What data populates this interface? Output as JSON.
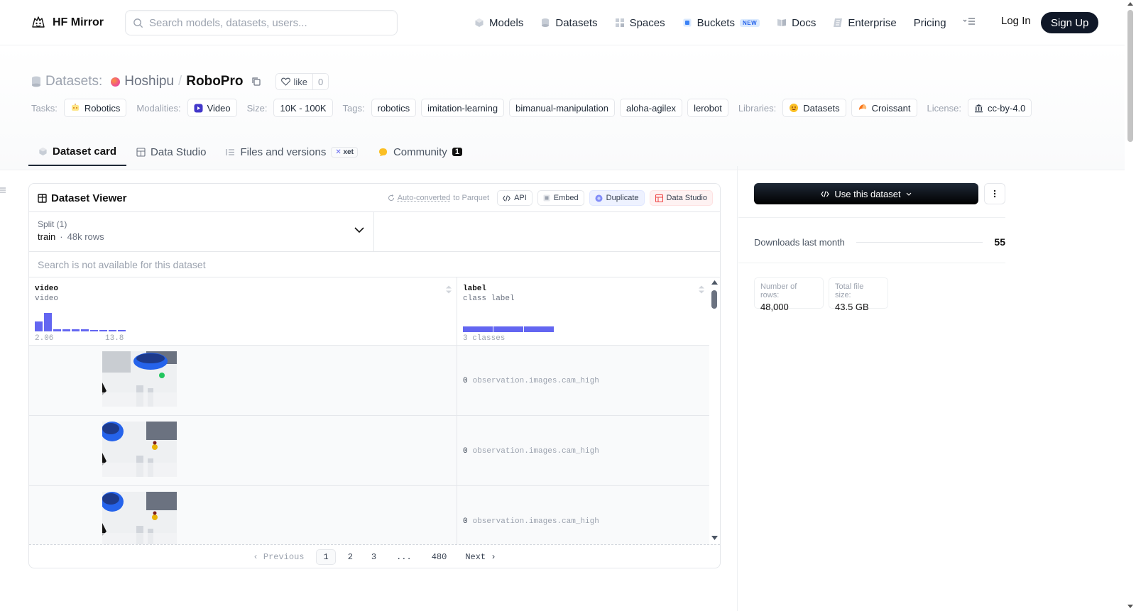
{
  "nav": {
    "brand": "HF Mirror",
    "search_placeholder": "Search models, datasets, users...",
    "links": [
      {
        "label": "Models",
        "icon": "cube-icon"
      },
      {
        "label": "Datasets",
        "icon": "database-icon"
      },
      {
        "label": "Spaces",
        "icon": "grid-icon"
      },
      {
        "label": "Buckets",
        "icon": "bucket-icon",
        "badge": "NEW"
      },
      {
        "label": "Docs",
        "icon": "book-icon"
      },
      {
        "label": "Enterprise",
        "icon": "enterprise-icon"
      },
      {
        "label": "Pricing"
      }
    ],
    "login": "Log In",
    "signup": "Sign Up"
  },
  "header": {
    "prefix": "Datasets:",
    "owner": "Hoshipu",
    "repo": "RoboPro",
    "like_label": "like",
    "like_count": "0"
  },
  "tags": {
    "tasks_label": "Tasks:",
    "tasks": [
      "Robotics"
    ],
    "modalities_label": "Modalities:",
    "modalities": [
      "Video"
    ],
    "size_label": "Size:",
    "size": [
      "10K - 100K"
    ],
    "tags_label": "Tags:",
    "tags": [
      "robotics",
      "imitation-learning",
      "bimanual-manipulation",
      "aloha-agilex",
      "lerobot"
    ],
    "libraries_label": "Libraries:",
    "libraries": [
      "Datasets",
      "Croissant"
    ],
    "license_label": "License:",
    "license": [
      "cc-by-4.0"
    ]
  },
  "tabs": [
    {
      "label": "Dataset card",
      "active": true
    },
    {
      "label": "Data Studio"
    },
    {
      "label": "Files and versions",
      "badge": "xet"
    },
    {
      "label": "Community",
      "count": "1"
    }
  ],
  "viewer": {
    "title": "Dataset Viewer",
    "auto_converted": "Auto-converted",
    "to_parquet": "to Parquet",
    "api": "API",
    "embed": "Embed",
    "duplicate": "Duplicate",
    "data_studio": "Data Studio",
    "split_label": "Split (1)",
    "split_name": "train",
    "split_rows": "48k rows",
    "search_note": "Search is not available for this dataset",
    "columns": [
      {
        "name": "video",
        "type": "video",
        "min": "2.06",
        "max": "13.8",
        "hist": [
          0.55,
          1.0,
          0.13,
          0.13,
          0.13,
          0.1,
          0.07,
          0.07,
          0.04,
          0.04
        ]
      },
      {
        "name": "label",
        "type": "class label",
        "classes": "3 classes"
      }
    ],
    "rows": [
      {
        "label_num": "0",
        "label_text": "observation.images.cam_high"
      },
      {
        "label_num": "0",
        "label_text": "observation.images.cam_high"
      },
      {
        "label_num": "0",
        "label_text": "observation.images.cam_high"
      }
    ],
    "pager": {
      "previous": "Previous",
      "pages": [
        "1",
        "2",
        "3",
        "...",
        "480"
      ],
      "next": "Next"
    }
  },
  "sidebar": {
    "use_button": "Use this dataset",
    "downloads_label": "Downloads last month",
    "downloads_value": "55",
    "rows_label": "Number of rows:",
    "rows_value": "48,000",
    "size_label": "Total file size:",
    "size_value": "43.5 GB"
  },
  "colors": {
    "accent": "#6366f1",
    "primary_dark": "#101828"
  }
}
